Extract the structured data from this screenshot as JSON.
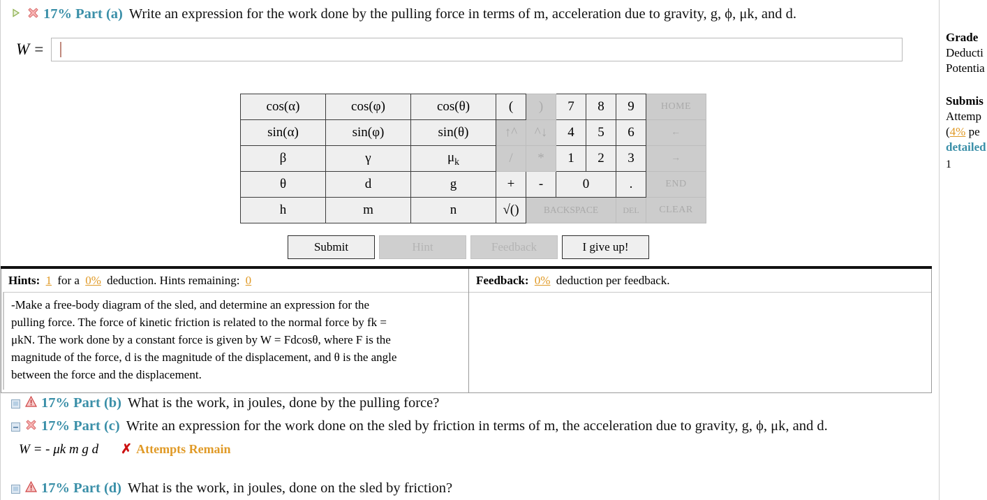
{
  "parts": {
    "a": {
      "status_icon": "red-x-icon",
      "expand_icon": "green-play-triangle-icon",
      "label": "17% Part (a)",
      "text": "Write an expression for the work done by the pulling force in terms of m, acceleration due to gravity, g, ϕ, μk, and d.",
      "answer_label": "W =",
      "answer_value": "",
      "answer_placeholder": ""
    },
    "b": {
      "status_icon": "warning-triangle-icon",
      "expand_icon": "expand-box-icon",
      "label": "17% Part (b)",
      "text": "What is the work, in joules, done by the pulling force?"
    },
    "c": {
      "status_icon": "red-x-icon",
      "expand_icon": "collapse-box-icon",
      "label": "17% Part (c)",
      "text": "Write an expression for the work done on the sled by friction in terms of m, the acceleration due to gravity, g, ϕ, μk, and d.",
      "answer_text": "W = - μk m g d",
      "result_mark": "✗",
      "result_text": "Attempts Remain"
    },
    "d": {
      "status_icon": "warning-triangle-icon",
      "expand_icon": "expand-box-icon",
      "label": "17% Part (d)",
      "text": "What is the work, in joules, done on the sled by friction?"
    }
  },
  "keypad": {
    "rows": [
      [
        {
          "label": "cos(α)",
          "type": "sym",
          "enabled": true
        },
        {
          "label": "cos(φ)",
          "type": "sym",
          "enabled": true
        },
        {
          "label": "cos(θ)",
          "type": "sym",
          "enabled": true
        },
        {
          "label": "(",
          "type": "op",
          "enabled": true
        },
        {
          "label": ")",
          "type": "op",
          "enabled": false
        },
        {
          "label": "7",
          "type": "num",
          "enabled": true
        },
        {
          "label": "8",
          "type": "num",
          "enabled": true
        },
        {
          "label": "9",
          "type": "num",
          "enabled": true
        },
        {
          "label": "HOME",
          "type": "nav",
          "enabled": false
        }
      ],
      [
        {
          "label": "sin(α)",
          "type": "sym",
          "enabled": true
        },
        {
          "label": "sin(φ)",
          "type": "sym",
          "enabled": true
        },
        {
          "label": "sin(θ)",
          "type": "sym",
          "enabled": true
        },
        {
          "label": "↑^",
          "type": "op",
          "enabled": false
        },
        {
          "label": "^↓",
          "type": "op",
          "enabled": false
        },
        {
          "label": "4",
          "type": "num",
          "enabled": true
        },
        {
          "label": "5",
          "type": "num",
          "enabled": true
        },
        {
          "label": "6",
          "type": "num",
          "enabled": true
        },
        {
          "label": "←",
          "type": "nav",
          "enabled": false
        }
      ],
      [
        {
          "label": "β",
          "type": "sym",
          "enabled": true
        },
        {
          "label": "γ",
          "type": "sym",
          "enabled": true
        },
        {
          "label": "μk",
          "type": "sym",
          "enabled": true,
          "sub": "k",
          "base": "μ"
        },
        {
          "label": "/",
          "type": "op",
          "enabled": false
        },
        {
          "label": "*",
          "type": "op",
          "enabled": false
        },
        {
          "label": "1",
          "type": "num",
          "enabled": true
        },
        {
          "label": "2",
          "type": "num",
          "enabled": true
        },
        {
          "label": "3",
          "type": "num",
          "enabled": true
        },
        {
          "label": "→",
          "type": "nav",
          "enabled": false
        }
      ],
      [
        {
          "label": "θ",
          "type": "sym",
          "enabled": true
        },
        {
          "label": "d",
          "type": "sym",
          "enabled": true
        },
        {
          "label": "g",
          "type": "sym",
          "enabled": true
        },
        {
          "label": "+",
          "type": "op",
          "enabled": true
        },
        {
          "label": "-",
          "type": "op",
          "enabled": true
        },
        {
          "label": "0",
          "type": "wide2",
          "enabled": true
        },
        {
          "label": ".",
          "type": "op",
          "enabled": true
        },
        {
          "label": "END",
          "type": "nav",
          "enabled": false
        }
      ],
      [
        {
          "label": "h",
          "type": "sym",
          "enabled": true
        },
        {
          "label": "m",
          "type": "sym",
          "enabled": true
        },
        {
          "label": "n",
          "type": "sym",
          "enabled": true
        },
        {
          "label": "√()",
          "type": "op",
          "enabled": true
        },
        {
          "label": "BACKSPACE",
          "type": "bsp",
          "enabled": false
        },
        {
          "label": "DEL",
          "type": "del",
          "enabled": false
        },
        {
          "label": "CLEAR",
          "type": "nav",
          "enabled": false
        }
      ]
    ]
  },
  "actions": {
    "submit": "Submit",
    "hint": "Hint",
    "feedback": "Feedback",
    "give_up": "I give up!"
  },
  "hints_panel": {
    "title": "Hints:",
    "count": "1",
    "for_a": "for a",
    "deduction_pct": "0%",
    "deduction_word": "deduction. Hints remaining:",
    "remaining": "0",
    "body_line1": "-Make a free-body diagram of the sled, and determine an expression for the",
    "body_line2": "pulling force. The force of kinetic friction is related to the normal force by fk =",
    "body_line3": "μkN. The work done by a constant force is given by W = Fdcosθ, where F is the",
    "body_line4": "magnitude of the force, d is the magnitude of the displacement, and θ is the angle",
    "body_line5": "between the force and the displacement."
  },
  "feedback_panel": {
    "title": "Feedback:",
    "deduction_pct": "0%",
    "text": "deduction per feedback."
  },
  "sidebar": {
    "grade_title": "Grade",
    "deduction_line": "Deducti",
    "potential_line": "Potentia",
    "submissions_title": "Submis",
    "attempts_line": "Attemp",
    "per_prefix": "(",
    "per_pct": "4%",
    "per_suffix": "pe",
    "detailed_link": "detailed",
    "count": "1"
  },
  "colors": {
    "part_label": "#3a8fa8",
    "accent_orange": "#e09a27",
    "error_red": "#cc1111",
    "key_bg": "#efefef",
    "key_disabled_bg": "#cccccc"
  }
}
